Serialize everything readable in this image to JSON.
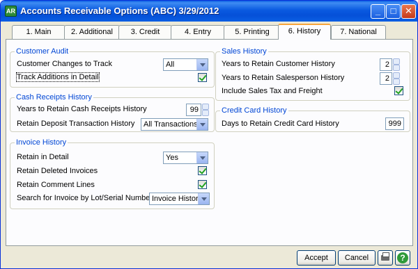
{
  "window": {
    "title": "Accounts Receivable Options (ABC) 3/29/2012",
    "app_icon": "AR",
    "minimize_glyph": "_",
    "maximize_glyph": "□",
    "close_glyph": "✕"
  },
  "tabs": [
    {
      "label": "1. Main"
    },
    {
      "label": "2. Additional"
    },
    {
      "label": "3. Credit"
    },
    {
      "label": "4. Entry"
    },
    {
      "label": "5. Printing"
    },
    {
      "label": "6. History",
      "active": true
    },
    {
      "label": "7. National"
    }
  ],
  "customer_audit": {
    "title": "Customer Audit",
    "changes_label": "Customer Changes to Track",
    "changes_value": "All",
    "track_label": "Track Additions in Detail",
    "track_checked": true
  },
  "cash_receipts": {
    "title": "Cash Receipts History",
    "years_label": "Years to Retain Cash Receipts History",
    "years_value": "99",
    "deposit_label": "Retain Deposit Transaction History",
    "deposit_value": "All Transactions"
  },
  "invoice_history": {
    "title": "Invoice History",
    "retain_label": "Retain in Detail",
    "retain_value": "Yes",
    "deleted_label": "Retain Deleted Invoices",
    "deleted_checked": true,
    "comment_label": "Retain Comment Lines",
    "comment_checked": true,
    "search_label": "Search for Invoice by Lot/Serial Number In",
    "search_value": "Invoice History"
  },
  "sales_history": {
    "title": "Sales History",
    "customer_label": "Years to Retain Customer History",
    "customer_value": "2",
    "salesperson_label": "Years to Retain Salesperson History",
    "salesperson_value": "2",
    "tax_label": "Include Sales Tax and Freight",
    "tax_checked": true
  },
  "credit_card": {
    "title": "Credit Card History",
    "days_label": "Days to Retain Credit Card History",
    "days_value": "999"
  },
  "buttons": {
    "accept": "Accept",
    "cancel": "Cancel",
    "print_icon": "printer-icon",
    "help_icon": "help-icon",
    "help_glyph": "?"
  }
}
